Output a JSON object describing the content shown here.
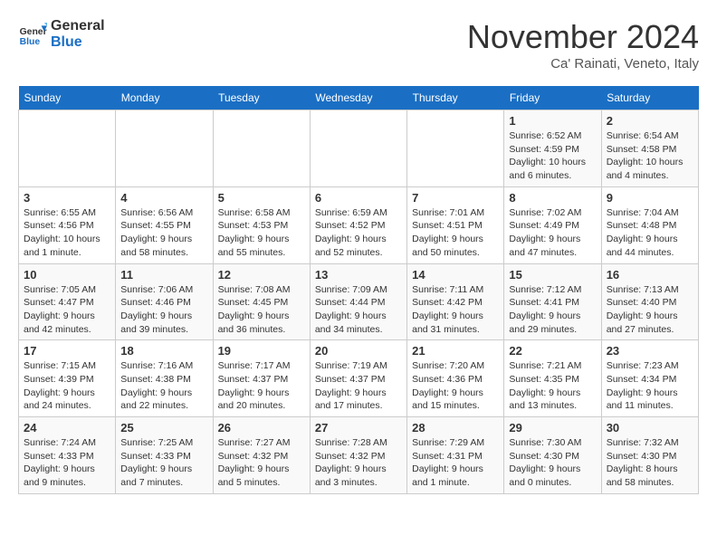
{
  "header": {
    "logo_general": "General",
    "logo_blue": "Blue",
    "month_title": "November 2024",
    "location": "Ca' Rainati, Veneto, Italy"
  },
  "calendar": {
    "days_of_week": [
      "Sunday",
      "Monday",
      "Tuesday",
      "Wednesday",
      "Thursday",
      "Friday",
      "Saturday"
    ],
    "weeks": [
      [
        {
          "day": "",
          "info": ""
        },
        {
          "day": "",
          "info": ""
        },
        {
          "day": "",
          "info": ""
        },
        {
          "day": "",
          "info": ""
        },
        {
          "day": "",
          "info": ""
        },
        {
          "day": "1",
          "info": "Sunrise: 6:52 AM\nSunset: 4:59 PM\nDaylight: 10 hours and 6 minutes."
        },
        {
          "day": "2",
          "info": "Sunrise: 6:54 AM\nSunset: 4:58 PM\nDaylight: 10 hours and 4 minutes."
        }
      ],
      [
        {
          "day": "3",
          "info": "Sunrise: 6:55 AM\nSunset: 4:56 PM\nDaylight: 10 hours and 1 minute."
        },
        {
          "day": "4",
          "info": "Sunrise: 6:56 AM\nSunset: 4:55 PM\nDaylight: 9 hours and 58 minutes."
        },
        {
          "day": "5",
          "info": "Sunrise: 6:58 AM\nSunset: 4:53 PM\nDaylight: 9 hours and 55 minutes."
        },
        {
          "day": "6",
          "info": "Sunrise: 6:59 AM\nSunset: 4:52 PM\nDaylight: 9 hours and 52 minutes."
        },
        {
          "day": "7",
          "info": "Sunrise: 7:01 AM\nSunset: 4:51 PM\nDaylight: 9 hours and 50 minutes."
        },
        {
          "day": "8",
          "info": "Sunrise: 7:02 AM\nSunset: 4:49 PM\nDaylight: 9 hours and 47 minutes."
        },
        {
          "day": "9",
          "info": "Sunrise: 7:04 AM\nSunset: 4:48 PM\nDaylight: 9 hours and 44 minutes."
        }
      ],
      [
        {
          "day": "10",
          "info": "Sunrise: 7:05 AM\nSunset: 4:47 PM\nDaylight: 9 hours and 42 minutes."
        },
        {
          "day": "11",
          "info": "Sunrise: 7:06 AM\nSunset: 4:46 PM\nDaylight: 9 hours and 39 minutes."
        },
        {
          "day": "12",
          "info": "Sunrise: 7:08 AM\nSunset: 4:45 PM\nDaylight: 9 hours and 36 minutes."
        },
        {
          "day": "13",
          "info": "Sunrise: 7:09 AM\nSunset: 4:44 PM\nDaylight: 9 hours and 34 minutes."
        },
        {
          "day": "14",
          "info": "Sunrise: 7:11 AM\nSunset: 4:42 PM\nDaylight: 9 hours and 31 minutes."
        },
        {
          "day": "15",
          "info": "Sunrise: 7:12 AM\nSunset: 4:41 PM\nDaylight: 9 hours and 29 minutes."
        },
        {
          "day": "16",
          "info": "Sunrise: 7:13 AM\nSunset: 4:40 PM\nDaylight: 9 hours and 27 minutes."
        }
      ],
      [
        {
          "day": "17",
          "info": "Sunrise: 7:15 AM\nSunset: 4:39 PM\nDaylight: 9 hours and 24 minutes."
        },
        {
          "day": "18",
          "info": "Sunrise: 7:16 AM\nSunset: 4:38 PM\nDaylight: 9 hours and 22 minutes."
        },
        {
          "day": "19",
          "info": "Sunrise: 7:17 AM\nSunset: 4:37 PM\nDaylight: 9 hours and 20 minutes."
        },
        {
          "day": "20",
          "info": "Sunrise: 7:19 AM\nSunset: 4:37 PM\nDaylight: 9 hours and 17 minutes."
        },
        {
          "day": "21",
          "info": "Sunrise: 7:20 AM\nSunset: 4:36 PM\nDaylight: 9 hours and 15 minutes."
        },
        {
          "day": "22",
          "info": "Sunrise: 7:21 AM\nSunset: 4:35 PM\nDaylight: 9 hours and 13 minutes."
        },
        {
          "day": "23",
          "info": "Sunrise: 7:23 AM\nSunset: 4:34 PM\nDaylight: 9 hours and 11 minutes."
        }
      ],
      [
        {
          "day": "24",
          "info": "Sunrise: 7:24 AM\nSunset: 4:33 PM\nDaylight: 9 hours and 9 minutes."
        },
        {
          "day": "25",
          "info": "Sunrise: 7:25 AM\nSunset: 4:33 PM\nDaylight: 9 hours and 7 minutes."
        },
        {
          "day": "26",
          "info": "Sunrise: 7:27 AM\nSunset: 4:32 PM\nDaylight: 9 hours and 5 minutes."
        },
        {
          "day": "27",
          "info": "Sunrise: 7:28 AM\nSunset: 4:32 PM\nDaylight: 9 hours and 3 minutes."
        },
        {
          "day": "28",
          "info": "Sunrise: 7:29 AM\nSunset: 4:31 PM\nDaylight: 9 hours and 1 minute."
        },
        {
          "day": "29",
          "info": "Sunrise: 7:30 AM\nSunset: 4:30 PM\nDaylight: 9 hours and 0 minutes."
        },
        {
          "day": "30",
          "info": "Sunrise: 7:32 AM\nSunset: 4:30 PM\nDaylight: 8 hours and 58 minutes."
        }
      ]
    ]
  }
}
